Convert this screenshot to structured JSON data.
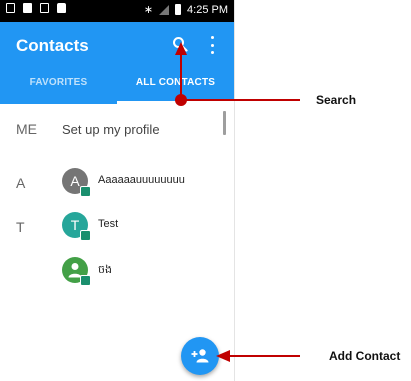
{
  "status_bar": {
    "time": "4:25 PM"
  },
  "app_bar": {
    "title": "Contacts"
  },
  "tabs": [
    {
      "label": "FAVORITES"
    },
    {
      "label": "ALL CONTACTS"
    }
  ],
  "profile": {
    "letter": "ME",
    "label": "Set up my profile"
  },
  "contacts": [
    {
      "section_letter": "A",
      "avatar_letter": "A",
      "avatar_color": "#757575",
      "name": "Aaaaaauuuuuuuu"
    },
    {
      "section_letter": "T",
      "avatar_letter": "T",
      "avatar_color": "#26a69a",
      "name": "Test"
    },
    {
      "section_letter": "",
      "avatar_letter": "",
      "avatar_color": "#43a047",
      "name": "ចង"
    }
  ],
  "callouts": {
    "search": "Search",
    "add_contact": "Add Contact"
  },
  "colors": {
    "primary": "#2196f3",
    "callout": "#c00000"
  },
  "icons": [
    "search-icon",
    "more-vert-icon",
    "add-person-icon",
    "person-icon"
  ]
}
